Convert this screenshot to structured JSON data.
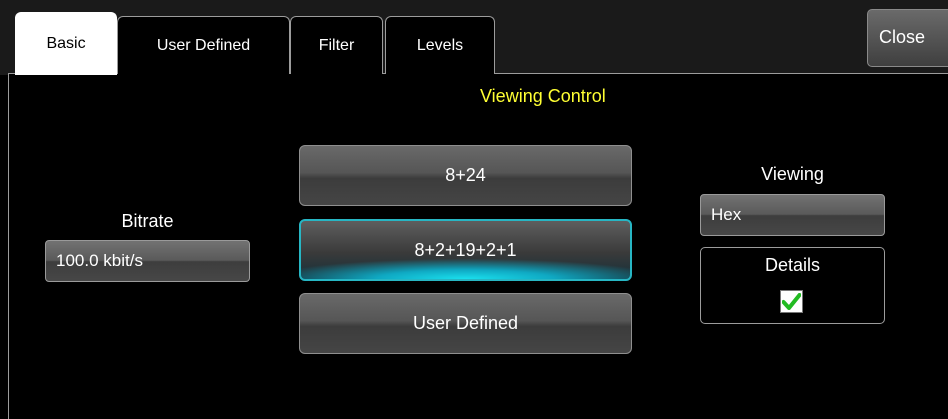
{
  "tabs": [
    {
      "label": "Basic",
      "active": true
    },
    {
      "label": "User Defined",
      "active": false
    },
    {
      "label": "Filter",
      "active": false
    },
    {
      "label": "Levels",
      "active": false
    }
  ],
  "close_label": "Close",
  "section_title": "Viewing Control",
  "bitrate": {
    "label": "Bitrate",
    "value": "100.0 kbit/s"
  },
  "frame_buttons": [
    {
      "label": "8+24",
      "selected": false
    },
    {
      "label": "8+2+19+2+1",
      "selected": true
    },
    {
      "label": "User Defined",
      "selected": false
    }
  ],
  "viewing": {
    "label": "Viewing",
    "value": "Hex"
  },
  "details": {
    "label": "Details",
    "checked": true
  },
  "colors": {
    "title_yellow": "#ffff33",
    "selected_cyan": "#1ae0ee",
    "check_green": "#22bb22"
  }
}
